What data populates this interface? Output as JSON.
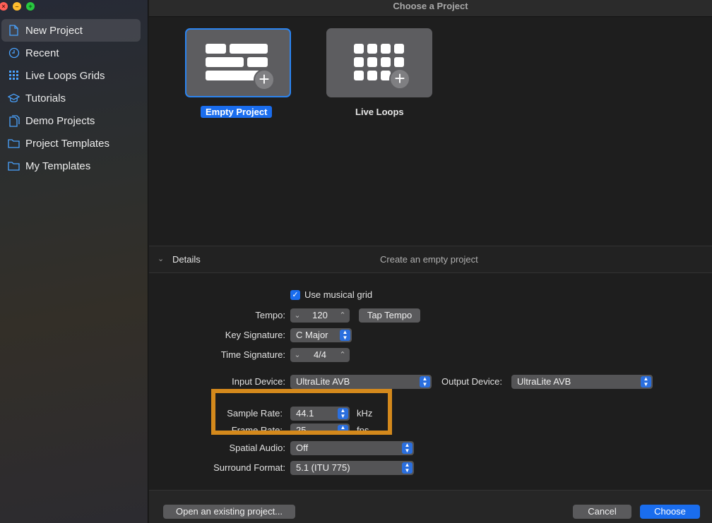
{
  "window": {
    "title": "Choose a Project"
  },
  "sidebar": {
    "items": [
      {
        "label": "New Project",
        "icon": "document-icon",
        "selected": true
      },
      {
        "label": "Recent",
        "icon": "clock-icon"
      },
      {
        "label": "Live Loops Grids",
        "icon": "grid-icon"
      },
      {
        "label": "Tutorials",
        "icon": "graduation-cap-icon"
      },
      {
        "label": "Demo Projects",
        "icon": "documents-icon"
      },
      {
        "label": "Project Templates",
        "icon": "folder-icon"
      },
      {
        "label": "My Templates",
        "icon": "folder-icon"
      }
    ]
  },
  "gallery": {
    "tiles": [
      {
        "label": "Empty Project",
        "selected": true
      },
      {
        "label": "Live Loops",
        "selected": false
      }
    ]
  },
  "details": {
    "title": "Details",
    "description": "Create an empty project",
    "use_grid_label": "Use musical grid",
    "use_grid_checked": true,
    "tempo": {
      "label": "Tempo:",
      "value": "120",
      "tap_label": "Tap Tempo"
    },
    "key_signature": {
      "label": "Key Signature:",
      "value": "C Major"
    },
    "time_signature": {
      "label": "Time Signature:",
      "value": "4/4"
    },
    "input_device": {
      "label": "Input Device:",
      "value": "UltraLite AVB"
    },
    "output_device": {
      "label": "Output Device:",
      "value": "UltraLite AVB"
    },
    "sample_rate": {
      "label": "Sample Rate:",
      "value": "44.1",
      "unit": "kHz"
    },
    "frame_rate": {
      "label": "Frame Rate:",
      "value": "25",
      "unit": "fps"
    },
    "spatial_audio": {
      "label": "Spatial Audio:",
      "value": "Off"
    },
    "surround_format": {
      "label": "Surround Format:",
      "value": "5.1 (ITU 775)"
    }
  },
  "footer": {
    "open_existing": "Open an existing project...",
    "cancel": "Cancel",
    "choose": "Choose"
  },
  "colors": {
    "accent": "#1a6dee",
    "highlight": "#d4891c"
  }
}
